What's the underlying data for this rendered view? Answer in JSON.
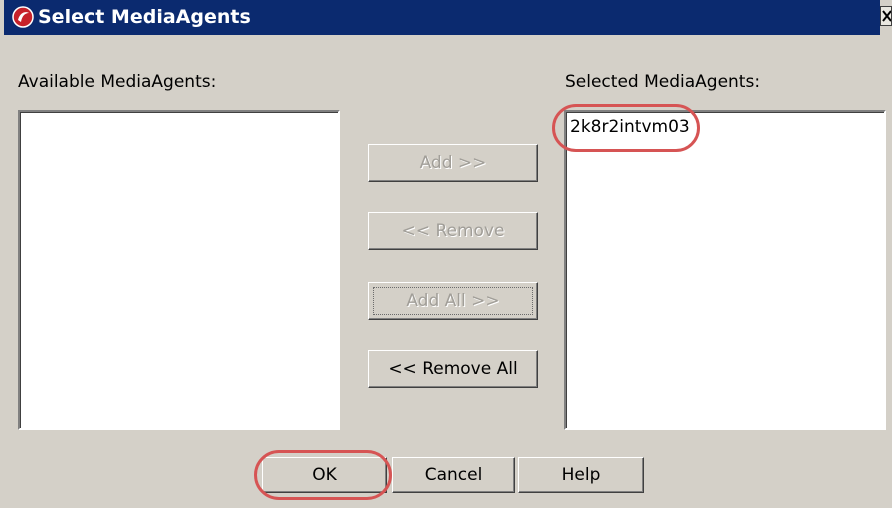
{
  "window": {
    "title": "Select MediaAgents",
    "icon": "app-logo-icon",
    "close_icon": "close-icon"
  },
  "available": {
    "label": "Available MediaAgents:",
    "items": []
  },
  "selected": {
    "label": "Selected MediaAgents:",
    "items": [
      "2k8r2intvm03"
    ]
  },
  "buttons": {
    "add": "Add >>",
    "remove": "<< Remove",
    "add_all": "Add All >>",
    "remove_all": "<< Remove All",
    "ok": "OK",
    "cancel": "Cancel",
    "help": "Help"
  },
  "states": {
    "add_enabled": false,
    "remove_enabled": false,
    "add_all_enabled": false,
    "remove_all_enabled": true
  },
  "colors": {
    "titlebar": "#0b2a6f",
    "dialog_background": "#d4d0c8",
    "annotation_ring": "#d65454",
    "app_icon": "#c7222a"
  }
}
